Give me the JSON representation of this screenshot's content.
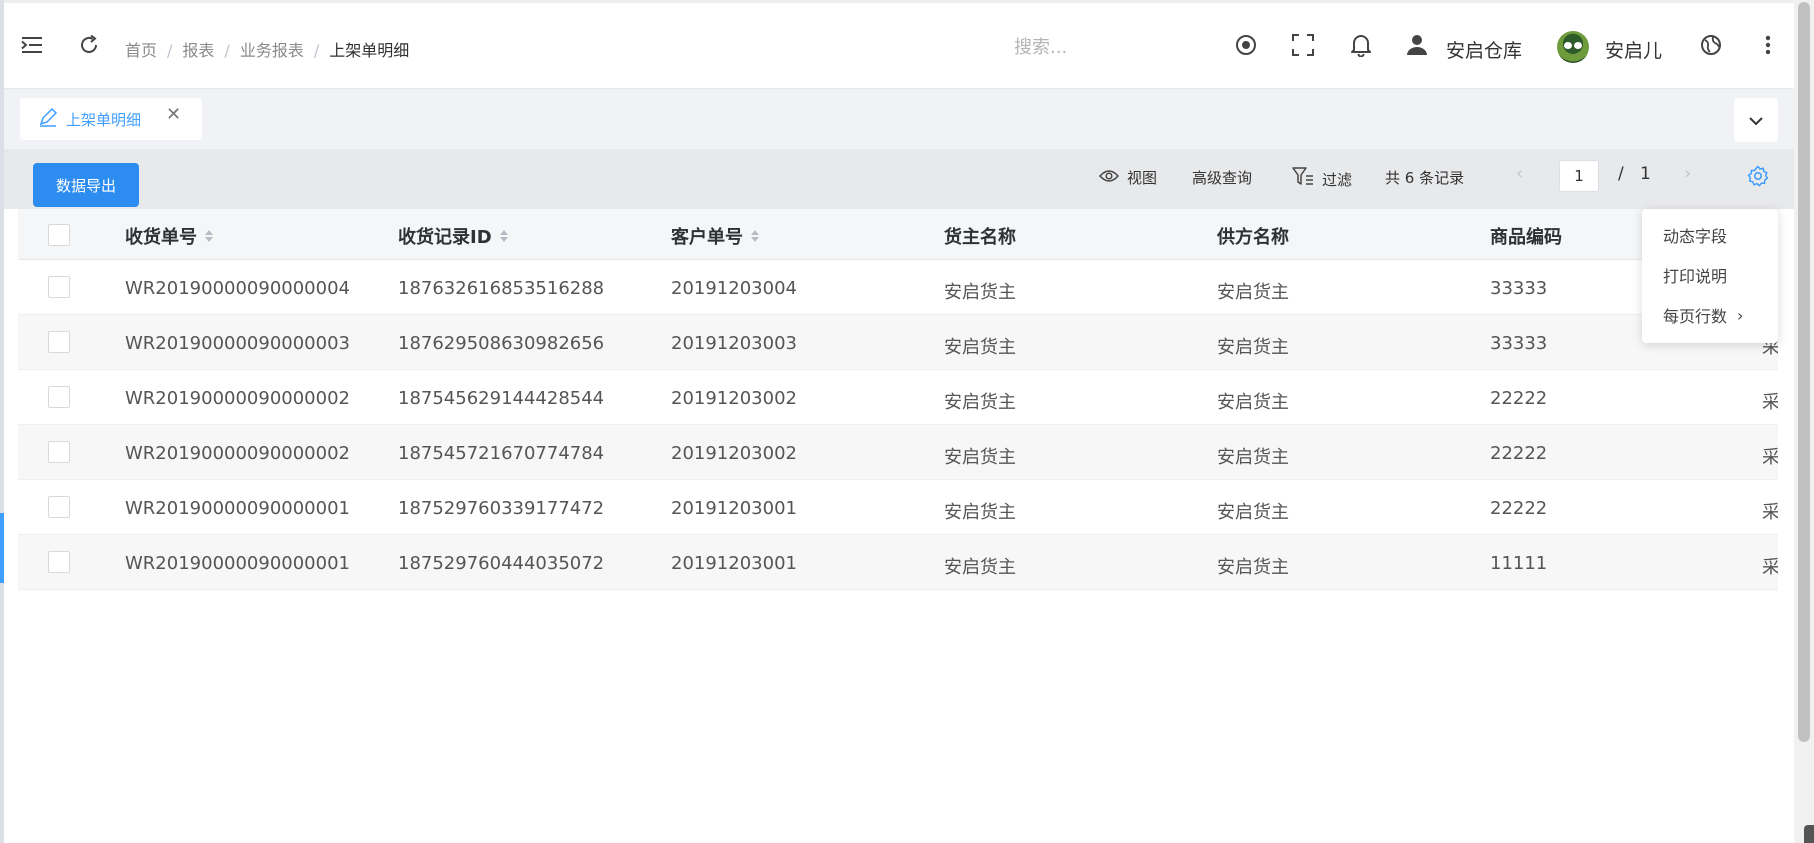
{
  "header": {
    "breadcrumbs": [
      "首页",
      "报表",
      "业务报表",
      "上架单明细"
    ],
    "search_placeholder": "搜索...",
    "warehouse": "安启仓库",
    "user_name": "安启儿"
  },
  "tabs": [
    {
      "label": "上架单明细",
      "active": true
    }
  ],
  "toolbar": {
    "export_label": "数据导出",
    "view_label": "视图",
    "advanced_query_label": "高级查询",
    "filter_label": "过滤",
    "record_count": "共 6 条记录",
    "page_current": "1",
    "page_separator": "/",
    "page_total": "1"
  },
  "table": {
    "columns": [
      "收货单号",
      "收货记录ID",
      "客户单号",
      "货主名称",
      "供方名称",
      "商品编码"
    ],
    "partial_column_text": "采",
    "rows": [
      {
        "order_no": "WR20190000090000004",
        "record_id": "187632616853516288",
        "customer_no": "20191203004",
        "owner": "安启货主",
        "supplier": "安启货主",
        "sku": "33333"
      },
      {
        "order_no": "WR20190000090000003",
        "record_id": "187629508630982656",
        "customer_no": "20191203003",
        "owner": "安启货主",
        "supplier": "安启货主",
        "sku": "33333"
      },
      {
        "order_no": "WR20190000090000002",
        "record_id": "187545629144428544",
        "customer_no": "20191203002",
        "owner": "安启货主",
        "supplier": "安启货主",
        "sku": "22222"
      },
      {
        "order_no": "WR20190000090000002",
        "record_id": "187545721670774784",
        "customer_no": "20191203002",
        "owner": "安启货主",
        "supplier": "安启货主",
        "sku": "22222"
      },
      {
        "order_no": "WR20190000090000001",
        "record_id": "187529760339177472",
        "customer_no": "20191203001",
        "owner": "安启货主",
        "supplier": "安启货主",
        "sku": "22222"
      },
      {
        "order_no": "WR20190000090000001",
        "record_id": "187529760444035072",
        "customer_no": "20191203001",
        "owner": "安启货主",
        "supplier": "安启货主",
        "sku": "11111"
      }
    ]
  },
  "settings_menu": {
    "items": [
      "动态字段",
      "打印说明",
      "每页行数"
    ]
  },
  "colors": {
    "primary": "#2d8cf0",
    "tab_active": "#409eff"
  }
}
